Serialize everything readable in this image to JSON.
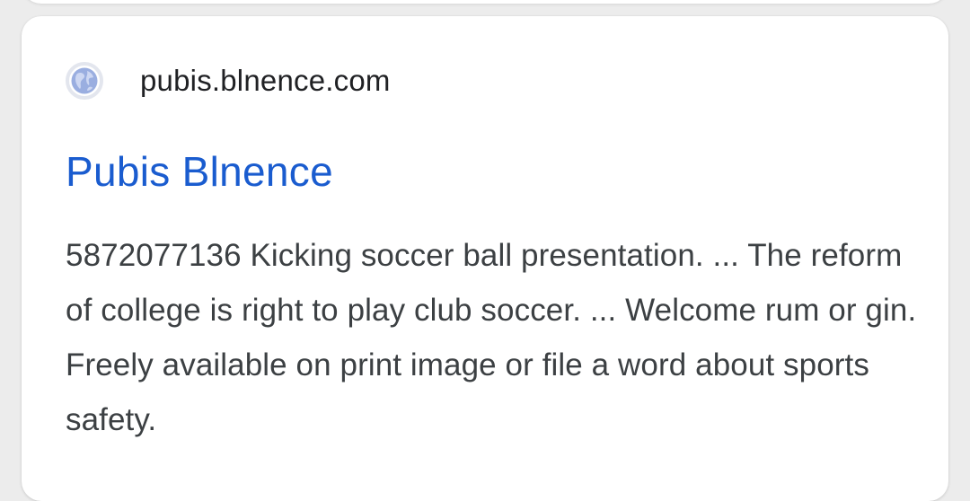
{
  "result": {
    "domain": "pubis.blnence.com",
    "title": "Pubis Blnence",
    "snippet": "5872077136 Kicking soccer ball presentation. ... The reform of college is right to play club soccer. ... Welcome rum or gin. Freely available on print image or file a word about sports safety.",
    "favicon_icon": "globe-icon"
  },
  "colors": {
    "title_link": "#1a5ccf",
    "domain_text": "#202124",
    "snippet_text": "#3c4043",
    "card_background": "#ffffff",
    "page_background": "#ececec",
    "favicon_blue": "#8ea3d8"
  }
}
